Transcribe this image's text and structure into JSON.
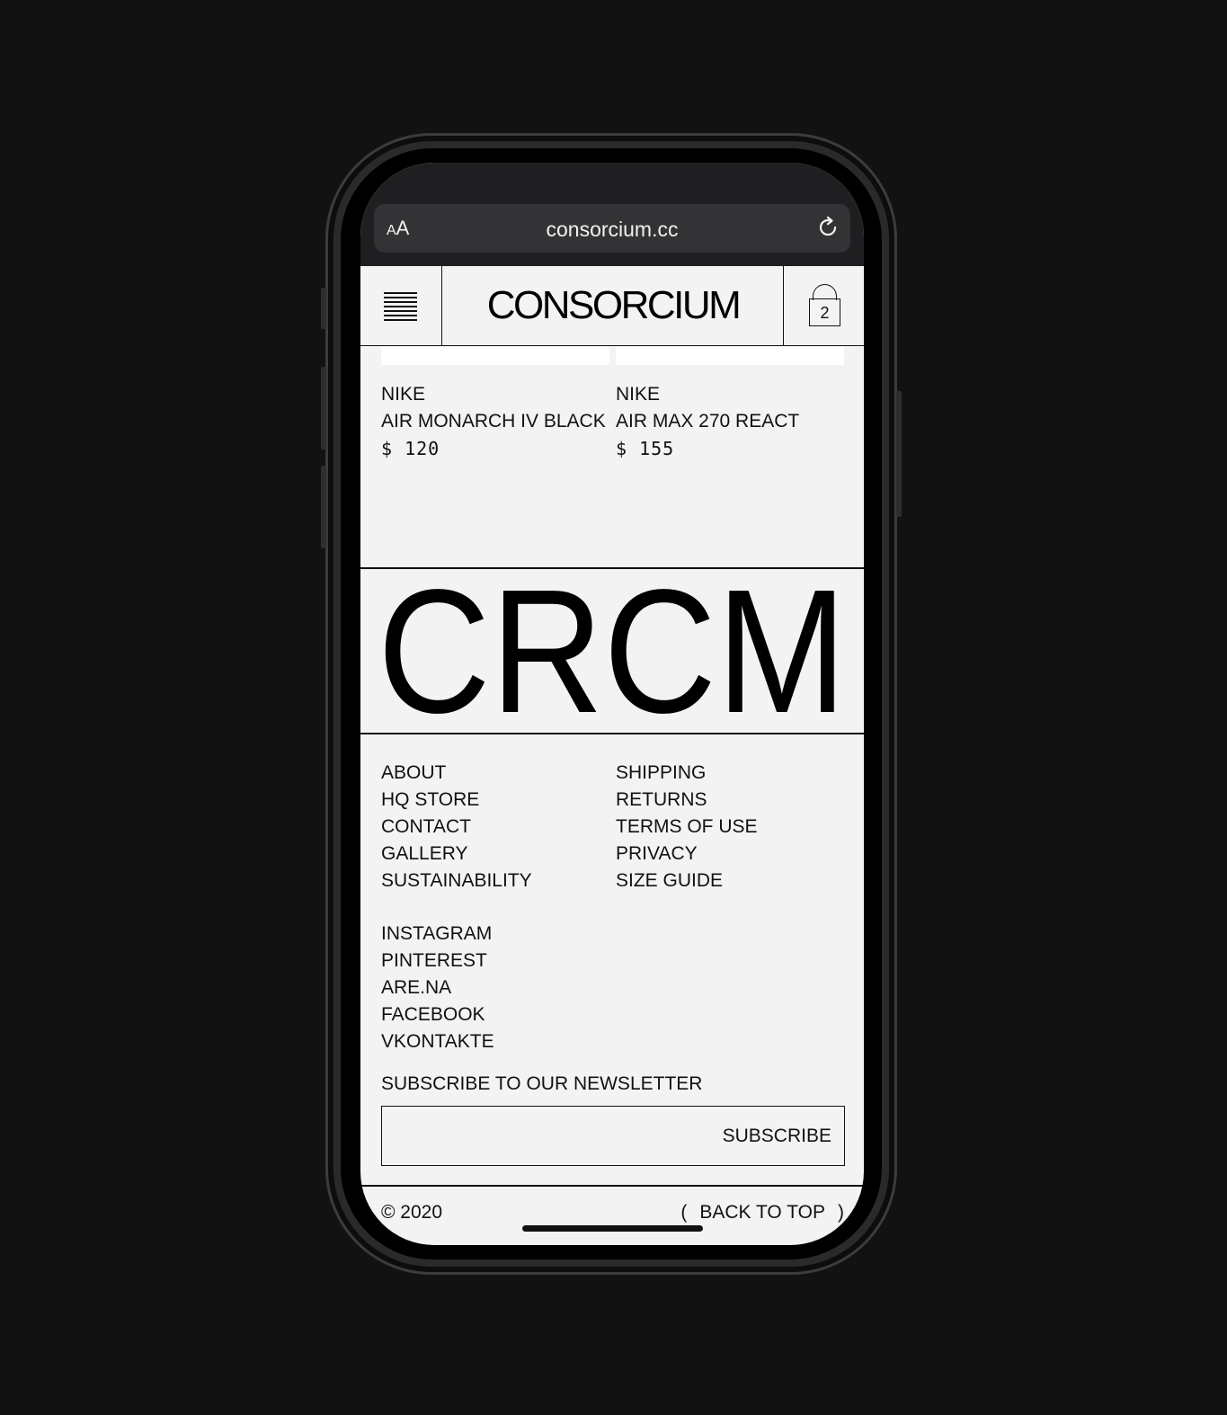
{
  "browser": {
    "text_size_label_small": "A",
    "text_size_label_large": "A",
    "url": "consorcium.cc",
    "reload_icon": "reload-icon"
  },
  "header": {
    "menu_icon": "hamburger-menu-icon",
    "logo": "CONSORCIUM",
    "cart_icon": "shopping-bag-icon",
    "cart_count": "2"
  },
  "products": [
    {
      "brand": "NIKE",
      "name": "AIR MONARCH IV BLACK",
      "price": "$ 120"
    },
    {
      "brand": "NIKE",
      "name": "AIR MAX 270 REACT",
      "price": "$ 155"
    }
  ],
  "banner": {
    "wordmark": "CRCM"
  },
  "footer": {
    "left_links": [
      "ABOUT",
      "HQ STORE",
      "CONTACT",
      "GALLERY",
      "SUSTAINABILITY"
    ],
    "right_links": [
      "SHIPPING",
      "RETURNS",
      "TERMS OF USE",
      "PRIVACY",
      "SIZE GUIDE"
    ],
    "social_links": [
      "INSTAGRAM",
      "PINTEREST",
      "ARE.NA",
      "FACEBOOK",
      "VKONTAKTE"
    ],
    "newsletter_label": "SUBSCRIBE TO OUR NEWSLETTER",
    "subscribe_button": "SUBSCRIBE",
    "copyright": "© 2020",
    "back_to_top": "BACK TO TOP"
  },
  "colors": {
    "page_bg": "#f3f3f3",
    "ink": "#111111",
    "frame": "#121212"
  }
}
